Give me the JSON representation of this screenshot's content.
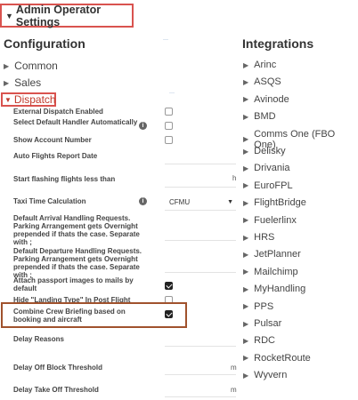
{
  "header": {
    "title": "Admin Operator Settings"
  },
  "configuration": {
    "title": "Configuration",
    "sections": [
      {
        "label": "Common"
      },
      {
        "label": "Sales"
      }
    ],
    "dispatch": {
      "label": "Dispatch",
      "rows": {
        "external_dispatch": {
          "label": "External Dispatch Enabled",
          "checked": false
        },
        "select_default_handler": {
          "label": "Select Default Handler Automatically",
          "checked": false
        },
        "show_account_number": {
          "label": "Show Account Number",
          "checked": false
        },
        "auto_flights_report_date": {
          "label": "Auto Flights Report Date"
        },
        "start_flashing": {
          "label": "Start flashing flights less than",
          "unit": "h"
        },
        "taxi_time": {
          "label": "Taxi Time Calculation",
          "value": "CFMU"
        },
        "default_arrival": {
          "label": "Default Arrival Handling Requests. Parking Arrangement gets Overnight prepended if thats the case. Separate with ;"
        },
        "default_departure": {
          "label": "Default Departure Handling Requests. Parking Arrangement gets Overnight prepended if thats the case. Separate with ;"
        },
        "attach_passport": {
          "label": "Attach passport images to mails by default",
          "checked": true
        },
        "hide_landing_type": {
          "label": "Hide \"Landing Type\" In Post Flight",
          "checked": false
        },
        "combine_crew": {
          "label": "Combine Crew Briefing based on booking and aircraft",
          "checked": true
        },
        "delay_reasons": {
          "label": "Delay Reasons"
        },
        "delay_off_block": {
          "label": "Delay Off Block Threshold",
          "unit": "m"
        },
        "delay_take_off": {
          "label": "Delay Take Off Threshold",
          "unit": "m"
        }
      }
    }
  },
  "integrations": {
    "title": "Integrations",
    "items": [
      "Arinc",
      "ASQS",
      "Avinode",
      "BMD",
      "Comms One (FBO One)",
      "Delisky",
      "Drivania",
      "EuroFPL",
      "FlightBridge",
      "Fuelerlinx",
      "HRS",
      "JetPlanner",
      "Mailchimp",
      "MyHandling",
      "PPS",
      "Pulsar",
      "RDC",
      "RocketRoute",
      "Wyvern"
    ]
  },
  "icons": {
    "info": "info-icon",
    "caret_right": "caret-right-icon",
    "caret_down": "caret-down-icon",
    "select_arrow": "dropdown-arrow-icon"
  },
  "colors": {
    "highlight_red": "#d9534f",
    "dispatch_red": "#c0392b",
    "combine_border": "#a0522d"
  }
}
